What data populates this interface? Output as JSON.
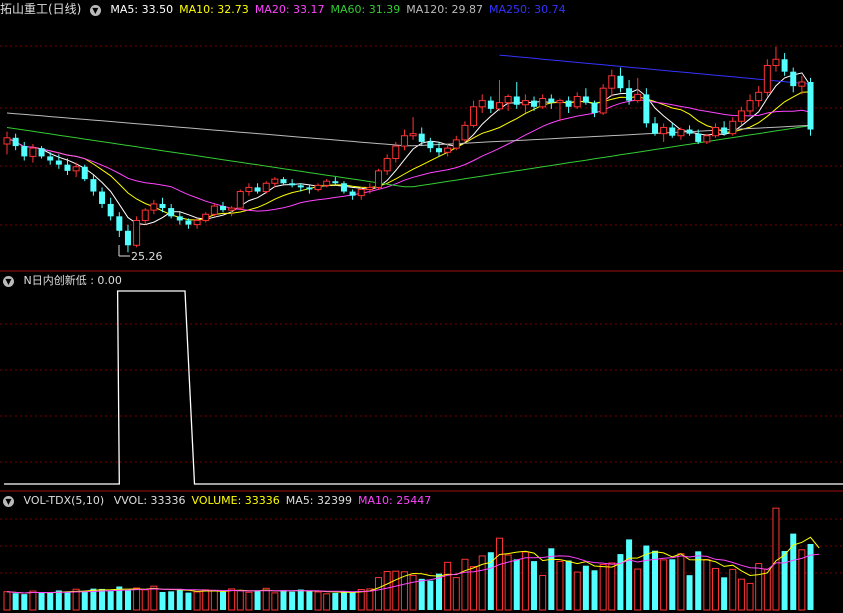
{
  "main_panel": {
    "title": "拓山重工(日线)",
    "indicators": [
      {
        "label": "MA5: 33.50",
        "color": "#ffffff"
      },
      {
        "label": "MA10: 32.73",
        "color": "#ffff00"
      },
      {
        "label": "MA20: 33.17",
        "color": "#ff44ff"
      },
      {
        "label": "MA60: 31.39",
        "color": "#33cc33"
      },
      {
        "label": "MA120: 29.87",
        "color": "#bbbbbb"
      },
      {
        "label": "MA250: 30.74",
        "color": "#3333ff"
      }
    ],
    "low_marker": "25.26"
  },
  "indicator_panel": {
    "title": "N日内创新低",
    "value": ": 0.00"
  },
  "volume_panel": {
    "title": "VOL-TDX(5,10)",
    "items": [
      {
        "label": "VVOL: 33336",
        "color": "#dddddd"
      },
      {
        "label": "VOLUME: 33336",
        "color": "#ffff00"
      },
      {
        "label": "MA5: 32399",
        "color": "#dddddd"
      },
      {
        "label": "MA10: 25447",
        "color": "#ff44ff"
      }
    ]
  },
  "colors": {
    "up": "#ff3333",
    "down": "#54ffff",
    "grid": "#7a0000",
    "divider": "#a01010"
  },
  "chart_data": {
    "type": "candlestick",
    "candles": [
      [
        30.5,
        31.1,
        30.0,
        30.8
      ],
      [
        30.8,
        31.0,
        30.2,
        30.4
      ],
      [
        30.4,
        30.6,
        29.7,
        29.9
      ],
      [
        29.9,
        30.5,
        29.6,
        30.3
      ],
      [
        30.3,
        30.4,
        29.8,
        29.9
      ],
      [
        29.9,
        30.1,
        29.5,
        29.7
      ],
      [
        29.7,
        30.0,
        29.3,
        29.5
      ],
      [
        29.5,
        29.8,
        29.0,
        29.2
      ],
      [
        29.2,
        29.6,
        28.9,
        29.4
      ],
      [
        29.4,
        29.5,
        28.7,
        28.8
      ],
      [
        28.8,
        29.0,
        28.0,
        28.2
      ],
      [
        28.2,
        28.4,
        27.4,
        27.6
      ],
      [
        27.6,
        27.9,
        26.8,
        27.0
      ],
      [
        27.0,
        27.2,
        26.0,
        26.3
      ],
      [
        26.3,
        26.6,
        25.26,
        25.6
      ],
      [
        25.6,
        27.0,
        25.5,
        26.8
      ],
      [
        26.8,
        27.4,
        26.6,
        27.3
      ],
      [
        27.3,
        27.8,
        27.1,
        27.6
      ],
      [
        27.6,
        27.9,
        27.2,
        27.4
      ],
      [
        27.4,
        27.6,
        26.9,
        27.0
      ],
      [
        27.0,
        27.2,
        26.6,
        26.8
      ],
      [
        26.8,
        26.9,
        26.4,
        26.6
      ],
      [
        26.6,
        26.9,
        26.4,
        26.8
      ],
      [
        26.8,
        27.2,
        26.7,
        27.1
      ],
      [
        27.1,
        27.6,
        27.0,
        27.5
      ],
      [
        27.5,
        27.7,
        27.2,
        27.3
      ],
      [
        27.3,
        27.5,
        27.0,
        27.4
      ],
      [
        27.4,
        28.3,
        27.3,
        28.2
      ],
      [
        28.2,
        28.6,
        28.0,
        28.4
      ],
      [
        28.4,
        28.6,
        28.1,
        28.2
      ],
      [
        28.2,
        28.7,
        28.1,
        28.6
      ],
      [
        28.6,
        28.9,
        28.4,
        28.8
      ],
      [
        28.8,
        28.9,
        28.5,
        28.6
      ],
      [
        28.6,
        28.8,
        28.4,
        28.5
      ],
      [
        28.5,
        28.6,
        28.2,
        28.4
      ],
      [
        28.4,
        28.5,
        28.1,
        28.3
      ],
      [
        28.3,
        28.6,
        28.2,
        28.5
      ],
      [
        28.5,
        28.8,
        28.4,
        28.7
      ],
      [
        28.7,
        28.9,
        28.5,
        28.6
      ],
      [
        28.6,
        28.7,
        28.1,
        28.2
      ],
      [
        28.2,
        28.3,
        27.8,
        28.0
      ],
      [
        28.0,
        28.4,
        27.8,
        28.3
      ],
      [
        28.3,
        28.6,
        28.1,
        28.4
      ],
      [
        28.4,
        29.3,
        28.3,
        29.2
      ],
      [
        29.2,
        30.0,
        29.0,
        29.8
      ],
      [
        29.8,
        30.6,
        29.6,
        30.4
      ],
      [
        30.4,
        31.2,
        30.2,
        30.9
      ],
      [
        30.9,
        31.8,
        30.7,
        31.0
      ],
      [
        31.0,
        31.3,
        30.4,
        30.6
      ],
      [
        30.6,
        30.8,
        30.1,
        30.3
      ],
      [
        30.3,
        30.6,
        29.9,
        30.1
      ],
      [
        30.1,
        30.5,
        29.9,
        30.3
      ],
      [
        30.3,
        30.9,
        30.2,
        30.7
      ],
      [
        30.7,
        31.6,
        30.6,
        31.4
      ],
      [
        31.4,
        32.6,
        31.3,
        32.3
      ],
      [
        32.3,
        32.9,
        32.0,
        32.6
      ],
      [
        32.6,
        32.8,
        32.0,
        32.2
      ],
      [
        32.2,
        33.6,
        32.1,
        32.5
      ],
      [
        32.5,
        32.9,
        32.1,
        32.8
      ],
      [
        32.8,
        33.5,
        32.2,
        32.4
      ],
      [
        32.4,
        32.9,
        32.0,
        32.6
      ],
      [
        32.6,
        32.8,
        32.1,
        32.3
      ],
      [
        32.3,
        32.9,
        32.2,
        32.7
      ],
      [
        32.7,
        32.9,
        32.2,
        32.5
      ],
      [
        32.5,
        32.7,
        31.6,
        32.6
      ],
      [
        32.6,
        32.8,
        32.0,
        32.3
      ],
      [
        32.3,
        33.0,
        32.2,
        32.8
      ],
      [
        32.8,
        33.2,
        32.4,
        32.5
      ],
      [
        32.5,
        32.6,
        31.8,
        32.0
      ],
      [
        32.0,
        33.4,
        31.9,
        33.2
      ],
      [
        33.2,
        34.1,
        32.8,
        33.8
      ],
      [
        33.8,
        34.2,
        33.0,
        33.2
      ],
      [
        33.2,
        33.6,
        32.4,
        32.6
      ],
      [
        32.6,
        33.7,
        32.5,
        32.9
      ],
      [
        32.9,
        33.2,
        31.3,
        31.5
      ],
      [
        31.5,
        31.8,
        30.9,
        31.0
      ],
      [
        31.0,
        31.5,
        30.6,
        31.3
      ],
      [
        31.3,
        31.5,
        30.8,
        30.9
      ],
      [
        30.9,
        31.3,
        30.7,
        31.2
      ],
      [
        31.2,
        31.4,
        30.9,
        31.0
      ],
      [
        31.0,
        31.2,
        30.5,
        30.6
      ],
      [
        30.6,
        31.0,
        30.5,
        30.9
      ],
      [
        30.9,
        31.5,
        30.8,
        31.3
      ],
      [
        31.3,
        31.6,
        30.9,
        31.0
      ],
      [
        31.0,
        31.8,
        30.9,
        31.6
      ],
      [
        31.6,
        32.3,
        31.4,
        32.1
      ],
      [
        32.1,
        32.9,
        31.9,
        32.6
      ],
      [
        32.6,
        33.3,
        32.3,
        33.0
      ],
      [
        33.0,
        34.6,
        32.8,
        34.3
      ],
      [
        34.3,
        35.2,
        34.0,
        34.6
      ],
      [
        34.6,
        34.9,
        33.8,
        34.0
      ],
      [
        34.0,
        34.2,
        33.0,
        33.3
      ],
      [
        33.3,
        33.8,
        32.9,
        33.5
      ],
      [
        33.5,
        33.7,
        30.9,
        31.2
      ]
    ],
    "volume": [
      6000,
      5500,
      5200,
      6200,
      5800,
      5600,
      6400,
      5900,
      6800,
      6300,
      7000,
      6900,
      6200,
      7700,
      6400,
      7200,
      6600,
      7800,
      5900,
      6100,
      6800,
      5700,
      5900,
      6600,
      6300,
      6000,
      6900,
      6400,
      5800,
      6300,
      7100,
      5600,
      6500,
      6000,
      6700,
      6200,
      5900,
      5300,
      5600,
      6200,
      5800,
      6700,
      6900,
      10600,
      12600,
      12700,
      12500,
      11300,
      10200,
      9600,
      11900,
      15600,
      10600,
      16600,
      14200,
      17700,
      18900,
      23500,
      18000,
      16600,
      19000,
      16000,
      11300,
      20200,
      15900,
      16200,
      12400,
      14500,
      13000,
      14900,
      15400,
      18300,
      23100,
      13400,
      21100,
      19400,
      16400,
      16600,
      18400,
      11400,
      19200,
      16500,
      13600,
      10700,
      13300,
      10100,
      8700,
      15200,
      13400,
      33336,
      19300,
      25000,
      19700,
      21600,
      15800
    ],
    "volume_max": 36000,
    "price_range": [
      24.5,
      36.5
    ],
    "newlow_series": {
      "pre": 0,
      "rise_index": 13.5,
      "top_start": 14.2,
      "top_end": 21.8,
      "fall_index": 23,
      "high": 1,
      "low": 0
    }
  }
}
